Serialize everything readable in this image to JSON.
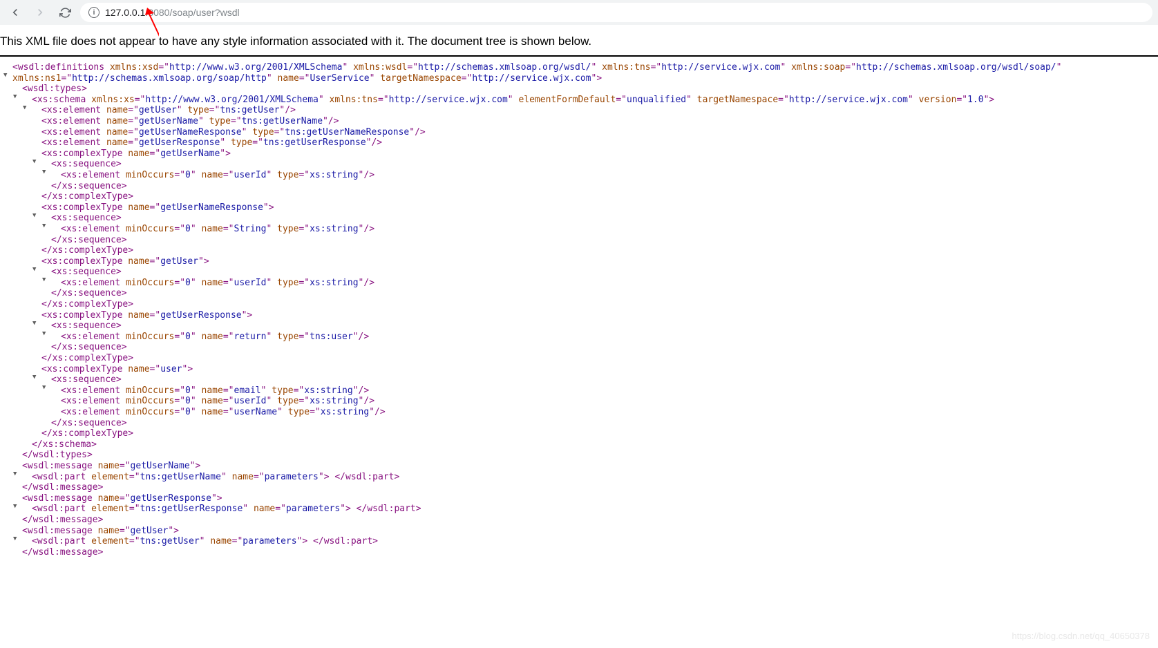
{
  "browser": {
    "url_host": "127.0.0.1",
    "url_port": ":8080",
    "url_path": "/soap/user?wsdl"
  },
  "banner": "This XML file does not appear to have any style information associated with it. The document tree is shown below.",
  "watermark": "https://blog.csdn.net/qq_40650378",
  "ns": {
    "xsd": "http://www.w3.org/2001/XMLSchema",
    "wsdl": "http://schemas.xmlsoap.org/wsdl/",
    "tns": "http://service.wjx.com",
    "soap": "http://schemas.xmlsoap.org/wsdl/soap/",
    "ns1": "http://schemas.xmlsoap.org/soap/http",
    "svcName": "UserService",
    "targetNs": "http://service.wjx.com"
  },
  "schema": {
    "xs": "http://www.w3.org/2001/XMLSchema",
    "tns": "http://service.wjx.com",
    "efd": "unqualified",
    "tn": "http://service.wjx.com",
    "ver": "1.0"
  },
  "el": {
    "e1n": "getUser",
    "e1t": "tns:getUser",
    "e2n": "getUserName",
    "e2t": "tns:getUserName",
    "e3n": "getUserNameResponse",
    "e3t": "tns:getUserNameResponse",
    "e4n": "getUserResponse",
    "e4t": "tns:getUserResponse"
  },
  "ct": {
    "c1": "getUserName",
    "c1en": "userId",
    "c1et": "xs:string",
    "c2": "getUserNameResponse",
    "c2en": "String",
    "c2et": "xs:string",
    "c3": "getUser",
    "c3en": "userId",
    "c3et": "xs:string",
    "c4": "getUserResponse",
    "c4en": "return",
    "c4et": "tns:user",
    "c5": "user",
    "u1n": "email",
    "u1t": "xs:string",
    "u2n": "userId",
    "u2t": "xs:string",
    "u3n": "userName",
    "u3t": "xs:string"
  },
  "mo": "0",
  "msg": {
    "m1": "getUserName",
    "m1e": "tns:getUserName",
    "pn": "parameters",
    "m2": "getUserResponse",
    "m2e": "tns:getUserResponse",
    "m3": "getUser",
    "m3e": "tns:getUser"
  }
}
